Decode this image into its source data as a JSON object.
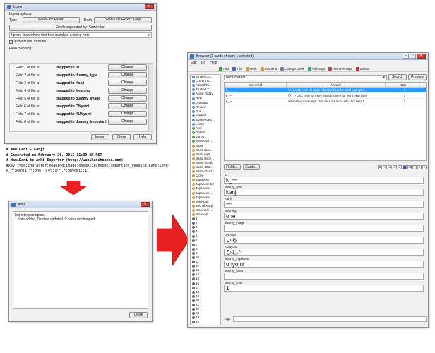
{
  "import": {
    "title": "Import",
    "import_options_label": "Import options",
    "type_label": "Type",
    "type_value": "WaniKani Export",
    "deck_label": "Deck",
    "deck_value": "WaniKani Export:Kanji",
    "separator_button": "Fields separated by: Semicolon",
    "duplicate_option": "Ignore lines where first field matches existing note",
    "allow_html_label": "Allow HTML in fields",
    "field_mapping_label": "Field mapping",
    "mappings": [
      {
        "field": "Field 1 of file is:",
        "mapped": "mapped to ID",
        "button": "Change"
      },
      {
        "field": "Field 2 of file is:",
        "mapped": "mapped to dummy_type",
        "button": "Change"
      },
      {
        "field": "Field 3 of file is:",
        "mapped": "mapped to Kanji",
        "button": "Change"
      },
      {
        "field": "Field 4 of file is:",
        "mapped": "mapped to Meaning",
        "button": "Change"
      },
      {
        "field": "Field 5 of file is:",
        "mapped": "mapped to dummy_image",
        "button": "Change"
      },
      {
        "field": "Field 6 of file is:",
        "mapped": "mapped to ONyomi",
        "button": "Change"
      },
      {
        "field": "Field 7 of file is:",
        "mapped": "mapped to KUNyomi",
        "button": "Change"
      },
      {
        "field": "Field 8 of file is:",
        "mapped": "mapped to dummy_important",
        "button": "Change"
      }
    ],
    "import_button": "Import",
    "close_button": "Close",
    "help_button": "Help"
  },
  "code_lines": [
    "# WaniKani - Kanji",
    "# Generated on February 26, 2015 11:39 AM PST",
    "# WaniKani to Anki Exporter (http://wanikanitoanki.com)",
    "#key;type;character;meaning;image;onyomi;kunyomi;important_reading;kana;level",
    "k_一;kanji;一;one;;いち;ひと.*;onyomi;;1"
  ],
  "anki": {
    "title": "Anki",
    "log_line1": "Importing complete.",
    "log_line2": "1 note added, 0 notes updated, 0 notes unchanged.",
    "close_button": "Close"
  },
  "browser": {
    "title": "Browser (3 cards shown; 1 selected)",
    "menu": [
      "Edit",
      "Go",
      "Help"
    ],
    "toolbar": [
      {
        "label": "Add",
        "color": "#3a9a3a"
      },
      {
        "label": "Info",
        "color": "#3a6fc4"
      },
      {
        "label": "Mark",
        "color": "#c9a53a"
      },
      {
        "label": "Suspend",
        "color": "#d0a020"
      },
      {
        "label": "Change Deck",
        "color": "#8a6fb0"
      },
      {
        "label": "Add Tags",
        "color": "#3a9a8a"
      },
      {
        "label": "Remove Tags",
        "color": "#b04a4a"
      },
      {
        "label": "Delete",
        "color": "#c03030"
      }
    ],
    "sidebar": [
      "Whole Col...",
      "Current D...",
      "Added To...",
      "Studied T...",
      "Again Today",
      "New",
      "Learning",
      "Review",
      "Due",
      "Marked",
      "Suspended",
      "Leech",
      "Anki",
      "Default",
      "Vorrat",
      "WaniKani ...",
      "Basic",
      "Basic (and...",
      "Basic (opti...",
      "Basic (type...",
      "Basic-2ceab",
      "Basic-d83...",
      "Basic-f7ac7",
      "Cloze",
      "Japanese",
      "Japanese 50",
      "Japanese-...",
      "Japanese-...",
      "Japanese-...",
      "TextFugu",
      "WKnai Kanji",
      "WaniKani ...",
      "Wanikani",
      "1",
      "2",
      "3",
      "4",
      "5",
      "6",
      "7",
      "8",
      "9",
      "10",
      "11",
      "12",
      "13",
      "14",
      "15",
      "16",
      "17",
      "18",
      "19",
      "20",
      "21",
      "22",
      "23",
      "24",
      "25",
      "26",
      "27",
      "28"
    ],
    "search_value": "deck:current",
    "search_button": "Search",
    "preview_button": "Preview",
    "columns": [
      "Sort Field",
      "Answer",
      "Due"
    ],
    "rows": [
      {
        "sort": "k_一",
        "answer": "いち  click here for more info click here for word examples",
        "due": "1"
      },
      {
        "sort": "k_一",
        "answer": "ひと.*  click here for more info click here for word examples",
        "due": "1"
      },
      {
        "sort": "k_一",
        "answer": "alternative meanings:  click here for more info click here f...",
        "due": "1"
      }
    ],
    "fields_button": "Fields...",
    "cards_button": "Cards...",
    "fields": [
      {
        "label": "ID",
        "value": "k_一"
      },
      {
        "label": "dummy_type",
        "value": "kanji"
      },
      {
        "label": "Kanji",
        "value": "一"
      },
      {
        "label": "Meaning",
        "value": "one"
      },
      {
        "label": "dummy_image",
        "value": ""
      },
      {
        "label": "ONyomi",
        "value": "いち"
      },
      {
        "label": "KUNyomi",
        "value": "ひと.*"
      },
      {
        "label": "dummy_important",
        "value": "onyomi"
      },
      {
        "label": "dummy_kana",
        "value": ""
      },
      {
        "label": "dummy_level",
        "value": "1"
      }
    ],
    "tags_label": "Tags"
  },
  "colors": {
    "arrow": "#e8201f",
    "selection": "#3399ff"
  }
}
